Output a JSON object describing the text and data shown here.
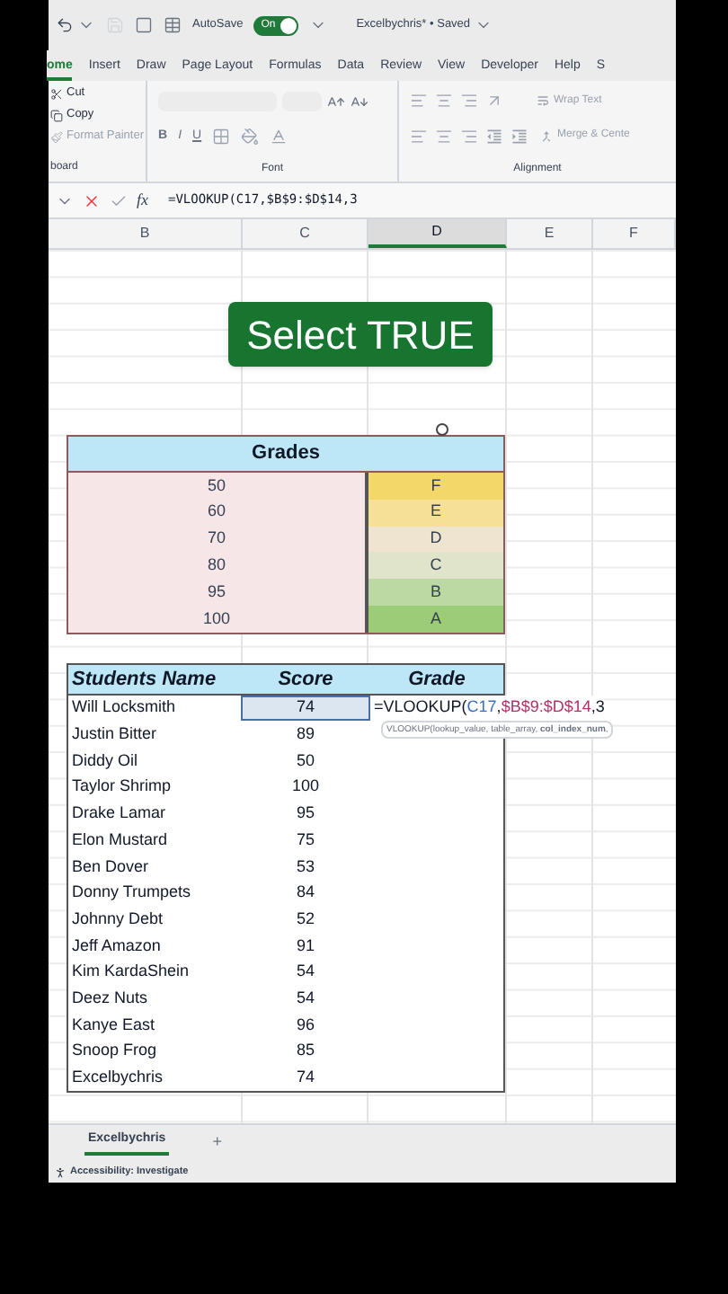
{
  "title_bar": {
    "autosave": {
      "label": "AutoSave",
      "on": true,
      "state_text": "On"
    },
    "title": "Excelbychris* • Saved"
  },
  "tabs": [
    {
      "label": "ome",
      "selected": true
    },
    {
      "label": "Insert",
      "selected": false
    },
    {
      "label": "Draw",
      "selected": false
    },
    {
      "label": "Page Layout",
      "selected": false
    },
    {
      "label": "Formulas",
      "selected": false
    },
    {
      "label": "Data",
      "selected": false
    },
    {
      "label": "Review",
      "selected": false
    },
    {
      "label": "View",
      "selected": false
    },
    {
      "label": "Developer",
      "selected": false
    },
    {
      "label": "Help",
      "selected": false
    },
    {
      "label": "S",
      "selected": false
    }
  ],
  "ribbon": {
    "clipboard": {
      "label": "board",
      "items": [
        {
          "kind": "cut",
          "label": "Cut",
          "disabled": false
        },
        {
          "kind": "copy",
          "label": "Copy",
          "disabled": false
        },
        {
          "kind": "painter",
          "label": "Format Painter",
          "disabled": true
        }
      ]
    },
    "font": {
      "label": "Font",
      "styles": [
        "B",
        "I",
        "U"
      ]
    },
    "alignment": {
      "label": "Alignment",
      "wrap_text": {
        "label": "Wrap Text",
        "disabled": true
      },
      "merge": {
        "label": "Merge & Cente",
        "disabled": true
      }
    }
  },
  "formula_bar": {
    "fx": "fx",
    "formula": "=VLOOKUP(C17,$B$9:$D$14,3"
  },
  "columns": [
    {
      "label": "B",
      "selected": false
    },
    {
      "label": "C",
      "selected": false
    },
    {
      "label": "D",
      "selected": true
    },
    {
      "label": "E",
      "selected": false
    },
    {
      "label": "F",
      "selected": false
    }
  ],
  "select_button": "Select TRUE",
  "grades": {
    "title": "Grades",
    "rows": [
      {
        "score": "50",
        "grade": "F",
        "color": "#f4d769"
      },
      {
        "score": "60",
        "grade": "E",
        "color": "#f6df96"
      },
      {
        "score": "70",
        "grade": "D",
        "color": "#efe4cf"
      },
      {
        "score": "80",
        "grade": "C",
        "color": "#dfe4cb"
      },
      {
        "score": "95",
        "grade": "B",
        "color": "#bcd9a3"
      },
      {
        "score": "100",
        "grade": "A",
        "color": "#9ccc78"
      }
    ]
  },
  "students": {
    "columns": [
      "Students Name",
      "Score",
      "Grade"
    ],
    "rows": [
      {
        "name": "Will Locksmith",
        "score": "74",
        "selected": true,
        "grade_formula": [
          {
            "text": "=VLOOKUP(",
            "kind": "plain"
          },
          {
            "text": "C17",
            "kind": "cell_ref"
          },
          {
            "separator": ",",
            "text": "$B$9:$D$14",
            "kind": "range_ref"
          },
          {
            "text": ",3",
            "kind": "plain"
          }
        ]
      },
      {
        "name": "Justin Bitter",
        "score": "89",
        "selected": false
      },
      {
        "name": "Diddy Oil",
        "score": "50",
        "selected": false
      },
      {
        "name": "Taylor Shrimp",
        "score": "100",
        "selected": false
      },
      {
        "name": "Drake Lamar",
        "score": "95",
        "selected": false
      },
      {
        "name": "Elon Mustard",
        "score": "75",
        "selected": false
      },
      {
        "name": "Ben Dover",
        "score": "53",
        "selected": false
      },
      {
        "name": "Donny Trumpets",
        "score": "84",
        "selected": false
      },
      {
        "name": "Johnny Debt",
        "score": "52",
        "selected": false
      },
      {
        "name": "Jeff Amazon",
        "score": "91",
        "selected": false
      },
      {
        "name": "Kim KardaShein",
        "score": "54",
        "selected": false
      },
      {
        "name": "Deez Nuts",
        "score": "54",
        "selected": false
      },
      {
        "name": "Kanye East",
        "score": "96",
        "selected": false
      },
      {
        "name": "Snoop Frog",
        "score": "85",
        "selected": false
      },
      {
        "name": "Excelbychris",
        "score": "74",
        "selected": false
      }
    ],
    "tooltip": "VLOOKUP(lookup_value, table_array, **col_index_num**,"
  },
  "sheet_tabs": [
    {
      "label": "Excelbychris",
      "selected": true
    }
  ],
  "add_sheet": "+",
  "status": "Accessibility: Investigate"
}
